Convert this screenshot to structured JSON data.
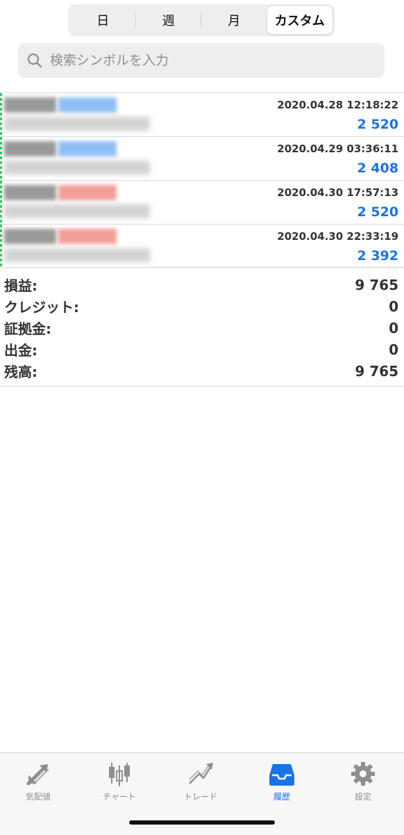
{
  "segments": [
    {
      "label": "日",
      "active": false
    },
    {
      "label": "週",
      "active": false
    },
    {
      "label": "月",
      "active": false
    },
    {
      "label": "カスタム",
      "active": true
    }
  ],
  "search": {
    "placeholder": "検索シンボルを入力",
    "value": ""
  },
  "deals": [
    {
      "time": "2020.04.28 12:18:22",
      "profit": "2 520",
      "side": "buy"
    },
    {
      "time": "2020.04.29 03:36:11",
      "profit": "2 408",
      "side": "buy"
    },
    {
      "time": "2020.04.30 17:57:13",
      "profit": "2 520",
      "side": "sell"
    },
    {
      "time": "2020.04.30 22:33:19",
      "profit": "2 392",
      "side": "sell"
    }
  ],
  "summary": {
    "profit_label": "損益:",
    "profit_value": "9 765",
    "credit_label": "クレジット:",
    "credit_value": "0",
    "deposit_label": "証拠金:",
    "deposit_value": "0",
    "withdrawal_label": "出金:",
    "withdrawal_value": "0",
    "balance_label": "残高:",
    "balance_value": "9 765"
  },
  "tabs": [
    {
      "label": "気配値",
      "icon": "quotes-arrows-icon",
      "active": false
    },
    {
      "label": "チャート",
      "icon": "candlestick-chart-icon",
      "active": false
    },
    {
      "label": "トレード",
      "icon": "trade-trend-icon",
      "active": false
    },
    {
      "label": "履歴",
      "icon": "history-inbox-icon",
      "active": true
    },
    {
      "label": "設定",
      "icon": "gear-icon",
      "active": false
    }
  ],
  "colors": {
    "accent": "#1a73e8",
    "profit": "#1a73e8",
    "inactive_tab": "#8e8e93",
    "position_marker": "#35c759"
  }
}
